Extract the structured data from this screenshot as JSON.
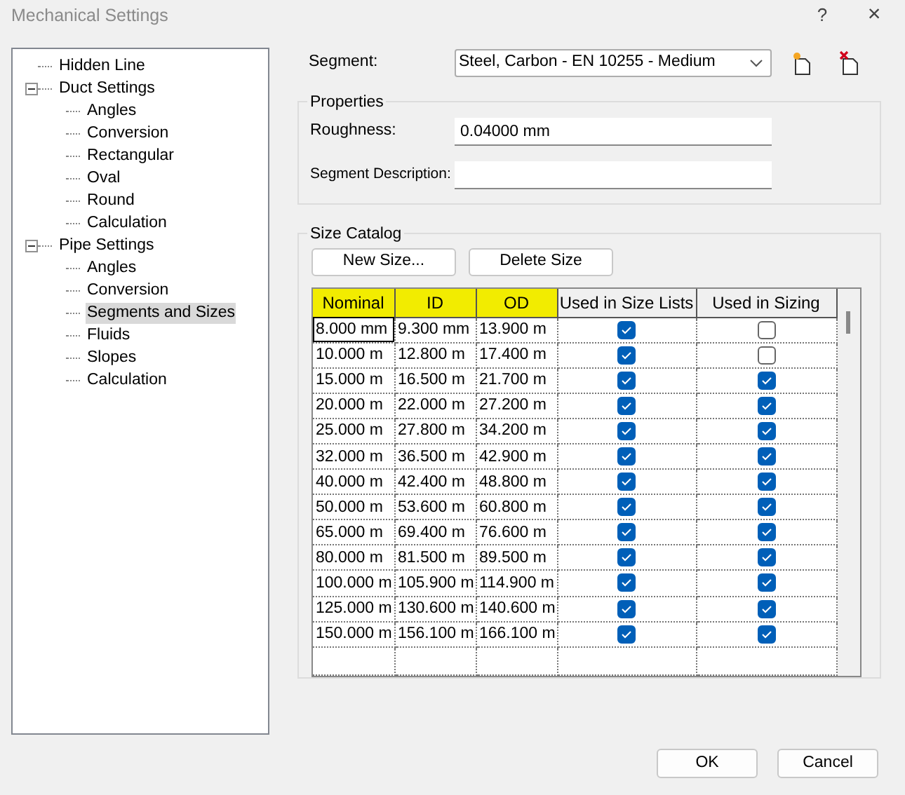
{
  "window": {
    "title": "Mechanical Settings",
    "help": "?",
    "close": "×"
  },
  "tree": [
    {
      "label": "Hidden Line",
      "selected": false
    },
    {
      "label": "Duct Settings",
      "selected": false,
      "expanded": true,
      "children": [
        {
          "label": "Angles",
          "selected": false
        },
        {
          "label": "Conversion",
          "selected": false
        },
        {
          "label": "Rectangular",
          "selected": false
        },
        {
          "label": "Oval",
          "selected": false
        },
        {
          "label": "Round",
          "selected": false
        },
        {
          "label": "Calculation",
          "selected": false
        }
      ]
    },
    {
      "label": "Pipe Settings",
      "selected": false,
      "expanded": true,
      "children": [
        {
          "label": "Angles",
          "selected": false
        },
        {
          "label": "Conversion",
          "selected": false
        },
        {
          "label": "Segments and Sizes",
          "selected": true
        },
        {
          "label": "Fluids",
          "selected": false
        },
        {
          "label": "Slopes",
          "selected": false
        },
        {
          "label": "Calculation",
          "selected": false
        }
      ]
    }
  ],
  "segment": {
    "label": "Segment:",
    "value": "Steel, Carbon - EN 10255 - Medium"
  },
  "properties": {
    "title": "Properties",
    "roughness_label": "Roughness:",
    "roughness": "0.04000 mm",
    "description_label": "Segment Description:"
  },
  "size_catalog": {
    "title": "Size Catalog",
    "buttons": [
      "New Size...",
      "Delete Size"
    ],
    "columns": [
      {
        "label": "Nominal",
        "highlighted": true
      },
      {
        "label": "ID",
        "highlighted": true
      },
      {
        "label": "OD",
        "highlighted": true
      },
      {
        "label": "Used in Size Lists",
        "highlighted": false
      },
      {
        "label": "Used in Sizing",
        "highlighted": false
      }
    ],
    "rows": [
      {
        "nominal": "8.000 mm",
        "id": "9.300 mm",
        "od": "13.900 m",
        "in_size_lists": true,
        "in_sizing": false,
        "focused": true
      },
      {
        "nominal": "10.000 m",
        "id": "12.800 m",
        "od": "17.400 m",
        "in_size_lists": true,
        "in_sizing": false,
        "focused": false
      },
      {
        "nominal": "15.000 m",
        "id": "16.500 m",
        "od": "21.700 m",
        "in_size_lists": true,
        "in_sizing": true,
        "focused": false
      },
      {
        "nominal": "20.000 m",
        "id": "22.000 m",
        "od": "27.200 m",
        "in_size_lists": true,
        "in_sizing": true,
        "focused": false
      },
      {
        "nominal": "25.000 m",
        "id": "27.800 m",
        "od": "34.200 m",
        "in_size_lists": true,
        "in_sizing": true,
        "focused": false
      },
      {
        "nominal": "32.000 m",
        "id": "36.500 m",
        "od": "42.900 m",
        "in_size_lists": true,
        "in_sizing": true,
        "focused": false
      },
      {
        "nominal": "40.000 m",
        "id": "42.400 m",
        "od": "48.800 m",
        "in_size_lists": true,
        "in_sizing": true,
        "focused": false
      },
      {
        "nominal": "50.000 m",
        "id": "53.600 m",
        "od": "60.800 m",
        "in_size_lists": true,
        "in_sizing": true,
        "focused": false
      },
      {
        "nominal": "65.000 m",
        "id": "69.400 m",
        "od": "76.600 m",
        "in_size_lists": true,
        "in_sizing": true,
        "focused": false
      },
      {
        "nominal": "80.000 m",
        "id": "81.500 m",
        "od": "89.500 m",
        "in_size_lists": true,
        "in_sizing": true,
        "focused": false
      },
      {
        "nominal": "100.000 m",
        "id": "105.900 m",
        "od": "114.900 m",
        "in_size_lists": true,
        "in_sizing": true,
        "focused": false
      },
      {
        "nominal": "125.000 m",
        "id": "130.600 m",
        "od": "140.600 m",
        "in_size_lists": true,
        "in_sizing": true,
        "focused": false
      },
      {
        "nominal": "150.000 m",
        "id": "156.100 m",
        "od": "166.100 m",
        "in_size_lists": true,
        "in_sizing": true,
        "focused": false
      }
    ]
  },
  "buttons": [
    "OK",
    "Cancel"
  ]
}
